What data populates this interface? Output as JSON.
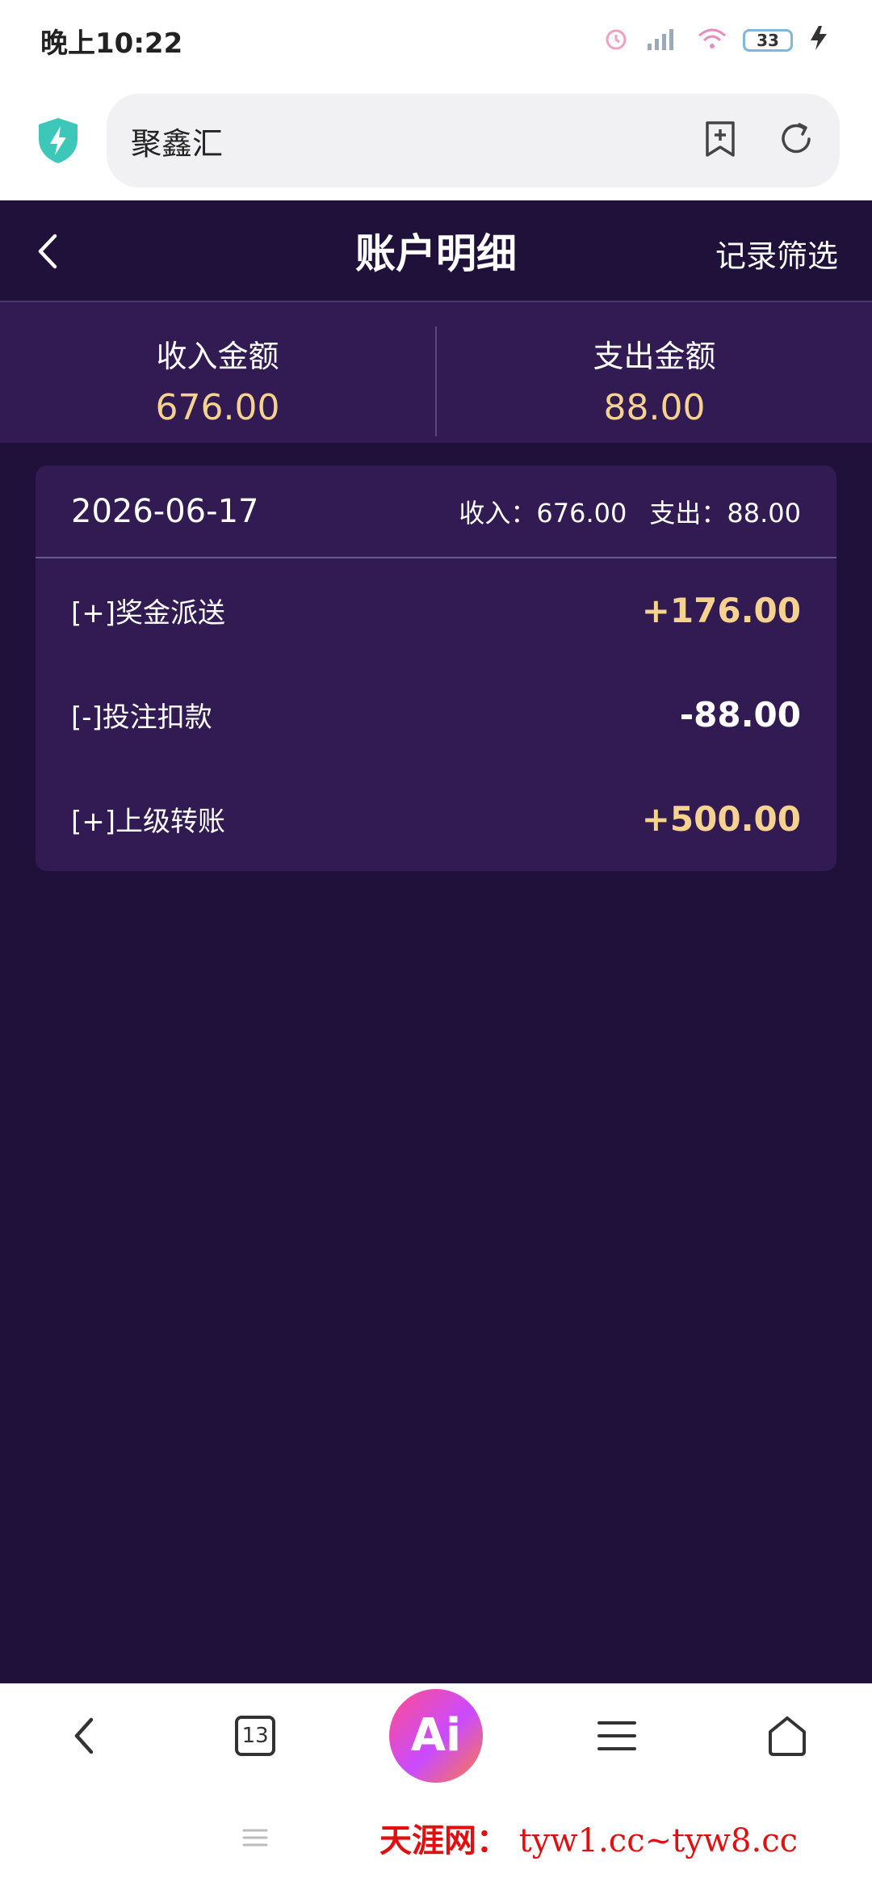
{
  "status_bar": {
    "time": "晚上10:22",
    "battery": "33"
  },
  "browser": {
    "site_name": "聚鑫汇"
  },
  "header": {
    "title": "账户明细",
    "filter_label": "记录筛选"
  },
  "summary": {
    "income_label": "收入金额",
    "income_value": "676.00",
    "expense_label": "支出金额",
    "expense_value": "88.00"
  },
  "day_group": {
    "date": "2026-06-17",
    "income_text": "收入：676.00",
    "expense_text": "支出：88.00",
    "transactions": [
      {
        "label": "[+]奖金派送",
        "amount": "+176.00",
        "kind": "income"
      },
      {
        "label": "[-]投注扣款",
        "amount": "-88.00",
        "kind": "expense"
      },
      {
        "label": "[+]上级转账",
        "amount": "+500.00",
        "kind": "income"
      }
    ]
  },
  "bottom_nav": {
    "tabs_count": "13",
    "ai_label": "Ai"
  },
  "watermark": {
    "cn": "天涯网：",
    "domains": "tyw1.cc~tyw8.cc"
  },
  "colors": {
    "background": "#1f1139",
    "panel": "#311b52",
    "accent_gold": "#f5d28f"
  }
}
